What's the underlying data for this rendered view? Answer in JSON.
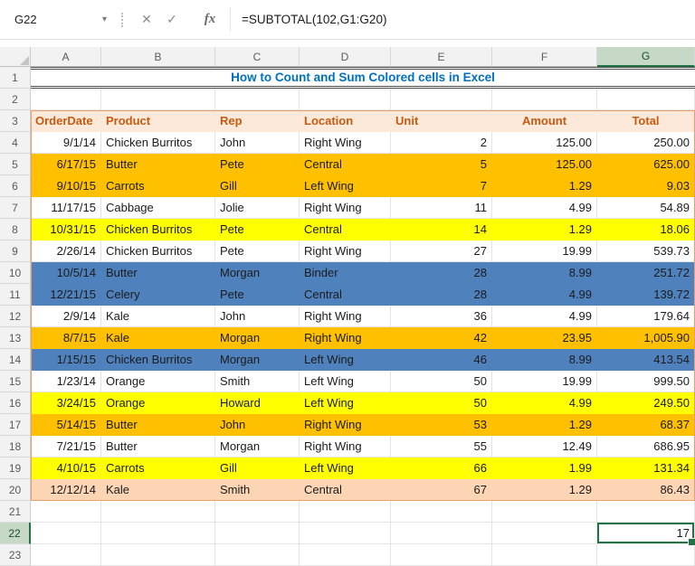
{
  "colors": {
    "accent_green": "#217346",
    "title_text": "#0070C0",
    "table_border": "#E8A06A",
    "header_fill": "#FDE9D9",
    "header_text": "#C55A11",
    "fills": {
      "orange": "#FFC000",
      "yellow": "#FFFF00",
      "blue": "#4F81BD",
      "peach": "#FCD5B4"
    }
  },
  "formula_bar": {
    "fx_label": "fx",
    "formula": "=SUBTOTAL(102,G1:G20)",
    "cancel_icon": "✕",
    "enter_icon": "✓",
    "dropdown_icon": "▾"
  },
  "sheet": {
    "columns": [
      "A",
      "B",
      "C",
      "D",
      "E",
      "F",
      "G"
    ],
    "row_count": 23,
    "title": "How to Count and Sum Colored cells in Excel",
    "header_row": [
      "OrderDate",
      "Product",
      "Rep",
      "Location",
      "Unit",
      "Amount",
      "Total"
    ],
    "data_rows": [
      {
        "row": 4,
        "fill": "none",
        "cells": [
          "9/1/14",
          "Chicken Burritos",
          "John",
          "Right Wing",
          "2",
          "125.00",
          "250.00"
        ]
      },
      {
        "row": 5,
        "fill": "orange",
        "cells": [
          "6/17/15",
          "Butter",
          "Pete",
          "Central",
          "5",
          "125.00",
          "625.00"
        ]
      },
      {
        "row": 6,
        "fill": "orange",
        "cells": [
          "9/10/15",
          "Carrots",
          "Gill",
          "Left Wing",
          "7",
          "1.29",
          "9.03"
        ]
      },
      {
        "row": 7,
        "fill": "none",
        "cells": [
          "11/17/15",
          "Cabbage",
          "Jolie",
          "Right Wing",
          "11",
          "4.99",
          "54.89"
        ]
      },
      {
        "row": 8,
        "fill": "yellow",
        "cells": [
          "10/31/15",
          "Chicken Burritos",
          "Pete",
          "Central",
          "14",
          "1.29",
          "18.06"
        ]
      },
      {
        "row": 9,
        "fill": "none",
        "cells": [
          "2/26/14",
          "Chicken Burritos",
          "Pete",
          "Right Wing",
          "27",
          "19.99",
          "539.73"
        ]
      },
      {
        "row": 10,
        "fill": "blue",
        "cells": [
          "10/5/14",
          "Butter",
          "Morgan",
          "Binder",
          "28",
          "8.99",
          "251.72"
        ]
      },
      {
        "row": 11,
        "fill": "blue",
        "cells": [
          "12/21/15",
          "Celery",
          "Pete",
          "Central",
          "28",
          "4.99",
          "139.72"
        ]
      },
      {
        "row": 12,
        "fill": "none",
        "cells": [
          "2/9/14",
          "Kale",
          "John",
          "Right Wing",
          "36",
          "4.99",
          "179.64"
        ]
      },
      {
        "row": 13,
        "fill": "orange",
        "cells": [
          "8/7/15",
          "Kale",
          "Morgan",
          "Right Wing",
          "42",
          "23.95",
          "1,005.90"
        ]
      },
      {
        "row": 14,
        "fill": "blue",
        "cells": [
          "1/15/15",
          "Chicken Burritos",
          "Morgan",
          "Left Wing",
          "46",
          "8.99",
          "413.54"
        ]
      },
      {
        "row": 15,
        "fill": "none",
        "cells": [
          "1/23/14",
          "Orange",
          "Smith",
          "Left Wing",
          "50",
          "19.99",
          "999.50"
        ]
      },
      {
        "row": 16,
        "fill": "yellow",
        "cells": [
          "3/24/15",
          "Orange",
          "Howard",
          "Left Wing",
          "50",
          "4.99",
          "249.50"
        ]
      },
      {
        "row": 17,
        "fill": "orange",
        "cells": [
          "5/14/15",
          "Butter",
          "John",
          "Right Wing",
          "53",
          "1.29",
          "68.37"
        ]
      },
      {
        "row": 18,
        "fill": "none",
        "cells": [
          "7/21/15",
          "Butter",
          "Morgan",
          "Right Wing",
          "55",
          "12.49",
          "686.95"
        ]
      },
      {
        "row": 19,
        "fill": "yellow",
        "cells": [
          "4/10/15",
          "Carrots",
          "Gill",
          "Left Wing",
          "66",
          "1.99",
          "131.34"
        ]
      },
      {
        "row": 20,
        "fill": "peach",
        "cells": [
          "12/12/14",
          "Kale",
          "Smith",
          "Central",
          "67",
          "1.29",
          "86.43"
        ]
      }
    ],
    "selection": {
      "ref": "G22",
      "col": "G",
      "row": 22,
      "value": "17"
    }
  }
}
